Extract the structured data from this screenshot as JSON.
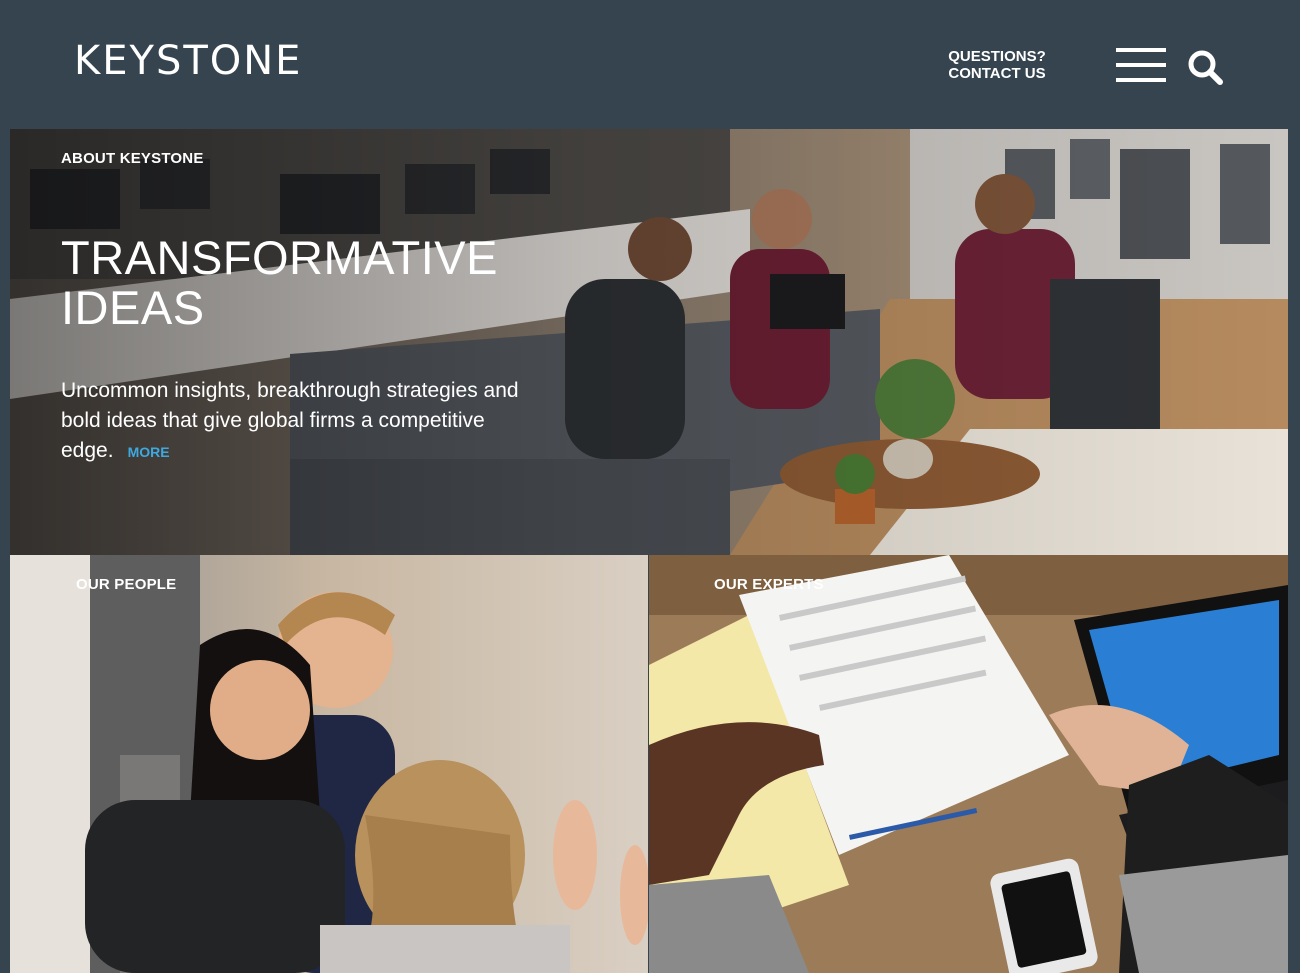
{
  "header": {
    "logo": "KEYSTONE",
    "contact_line1": "QUESTIONS?",
    "contact_line2": "CONTACT US"
  },
  "icons": {
    "menu": "hamburger-menu-icon",
    "search": "search-icon"
  },
  "hero": {
    "eyebrow": "ABOUT KEYSTONE",
    "title_line1": "TRANSFORMATIVE",
    "title_line2": "IDEAS",
    "text": "Uncommon insights, breakthrough strategies and bold ideas that give global firms a competitive edge.",
    "more": "MORE"
  },
  "tiles": {
    "left_label": "OUR PEOPLE",
    "right_label": "OUR EXPERTS"
  },
  "colors": {
    "header_bg": "#35444f",
    "link_blue": "#3ea9e0",
    "text": "#ffffff"
  }
}
